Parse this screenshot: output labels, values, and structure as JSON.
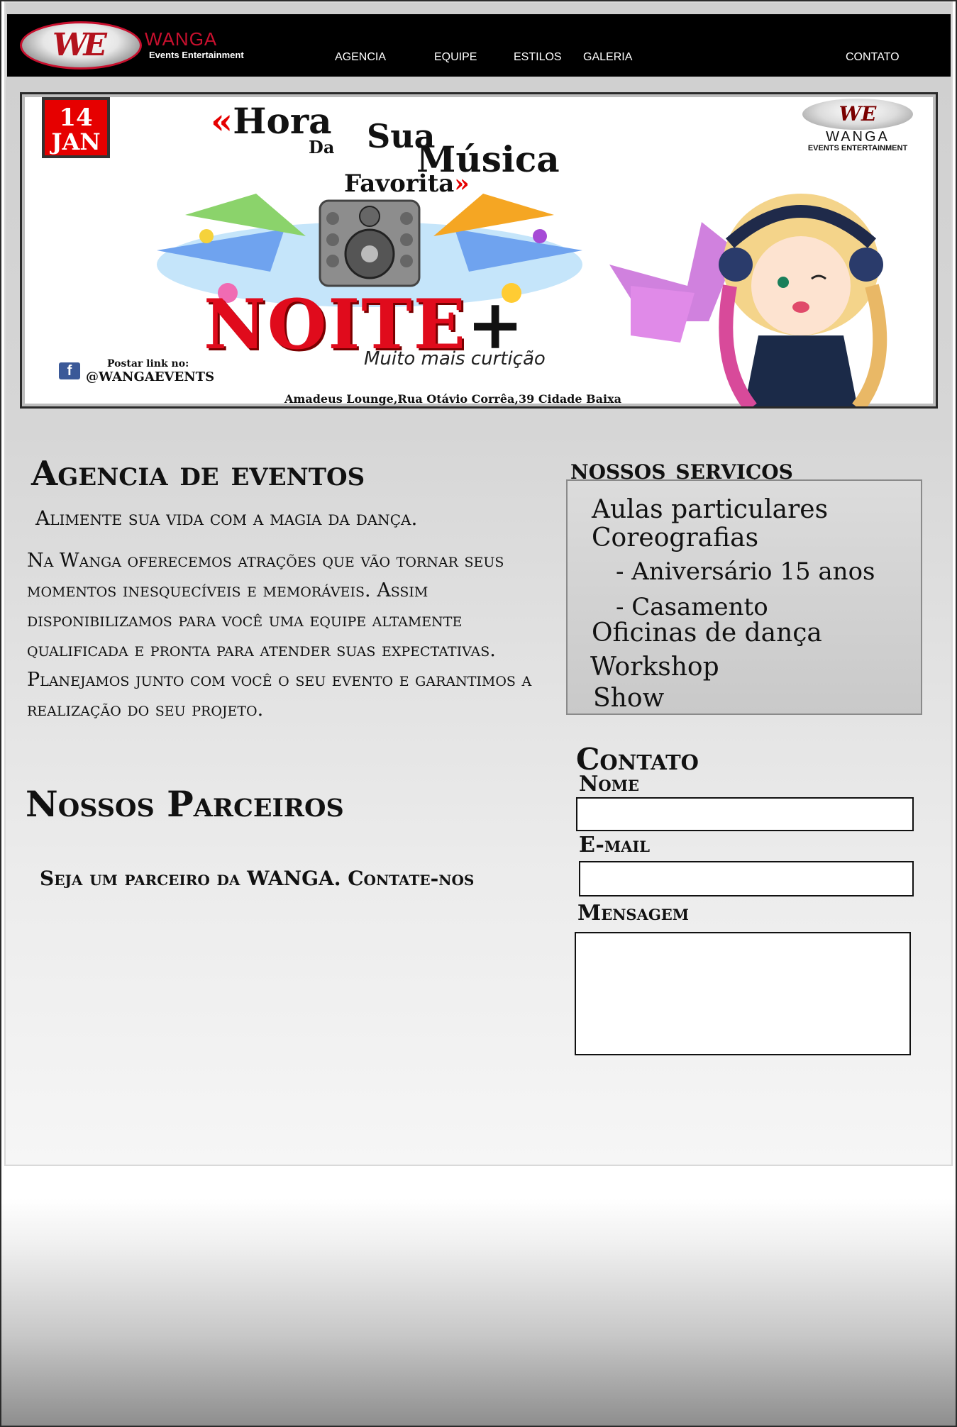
{
  "nav": {
    "logo_mark": "WE",
    "logo_name": "WANGA",
    "logo_sub": "Events Entertainment",
    "items": [
      {
        "label": "AGENCIA"
      },
      {
        "label": "EQUIPE"
      },
      {
        "label": "ESTILOS"
      },
      {
        "label": "GALERIA"
      },
      {
        "label": "CONTATO"
      }
    ]
  },
  "banner": {
    "date_day": "14",
    "date_month": "JAN",
    "quote_open": "«",
    "line1": "Hora",
    "line_da": "Da",
    "line_sua": "Sua",
    "line_musica": "Música",
    "line_favorita": "Favorita",
    "quote_close": "»",
    "event_name": "NOITE",
    "event_plus": "+",
    "tagline": "Muito mais curtição",
    "fb_icon": "f",
    "fb_post": "Postar link no:",
    "fb_handle": "@WANGAEVENTS",
    "address": "Amadeus Lounge,Rua Otávio Corrêa,39 Cidade Baixa",
    "logo_mark": "WE",
    "logo_name": "WANGA",
    "logo_sub": "EVENTS ENTERTAINMENT",
    "colors": {
      "accent": "#e60000",
      "facebook": "#3b5998"
    }
  },
  "agency": {
    "title": "Agencia de eventos",
    "tagline": "Alimente sua vida com a magia da dança.",
    "body": "Na Wanga oferecemos atrações que vão tornar seus momentos inesquecíveis e memoráveis. Assim disponibilizamos para você uma equipe altamente qualificada e pronta para atender suas expectativas. Planejamos junto com você  o seu evento e garantimos a realização do seu projeto."
  },
  "partners": {
    "title": "Nossos Parceiros",
    "text": "Seja um parceiro da WANGA. Contate-nos"
  },
  "services": {
    "title": "nossos serviços",
    "items": [
      "Aulas particulares",
      "Coreografias",
      "- Aniversário 15 anos",
      "- Casamento",
      "Oficinas de dança",
      "Workshop",
      "Show"
    ]
  },
  "contact": {
    "title": "Contato",
    "name_label": "Nome",
    "email_label": "E-mail",
    "message_label": "Mensagem",
    "name_value": "",
    "email_value": "",
    "message_value": ""
  }
}
